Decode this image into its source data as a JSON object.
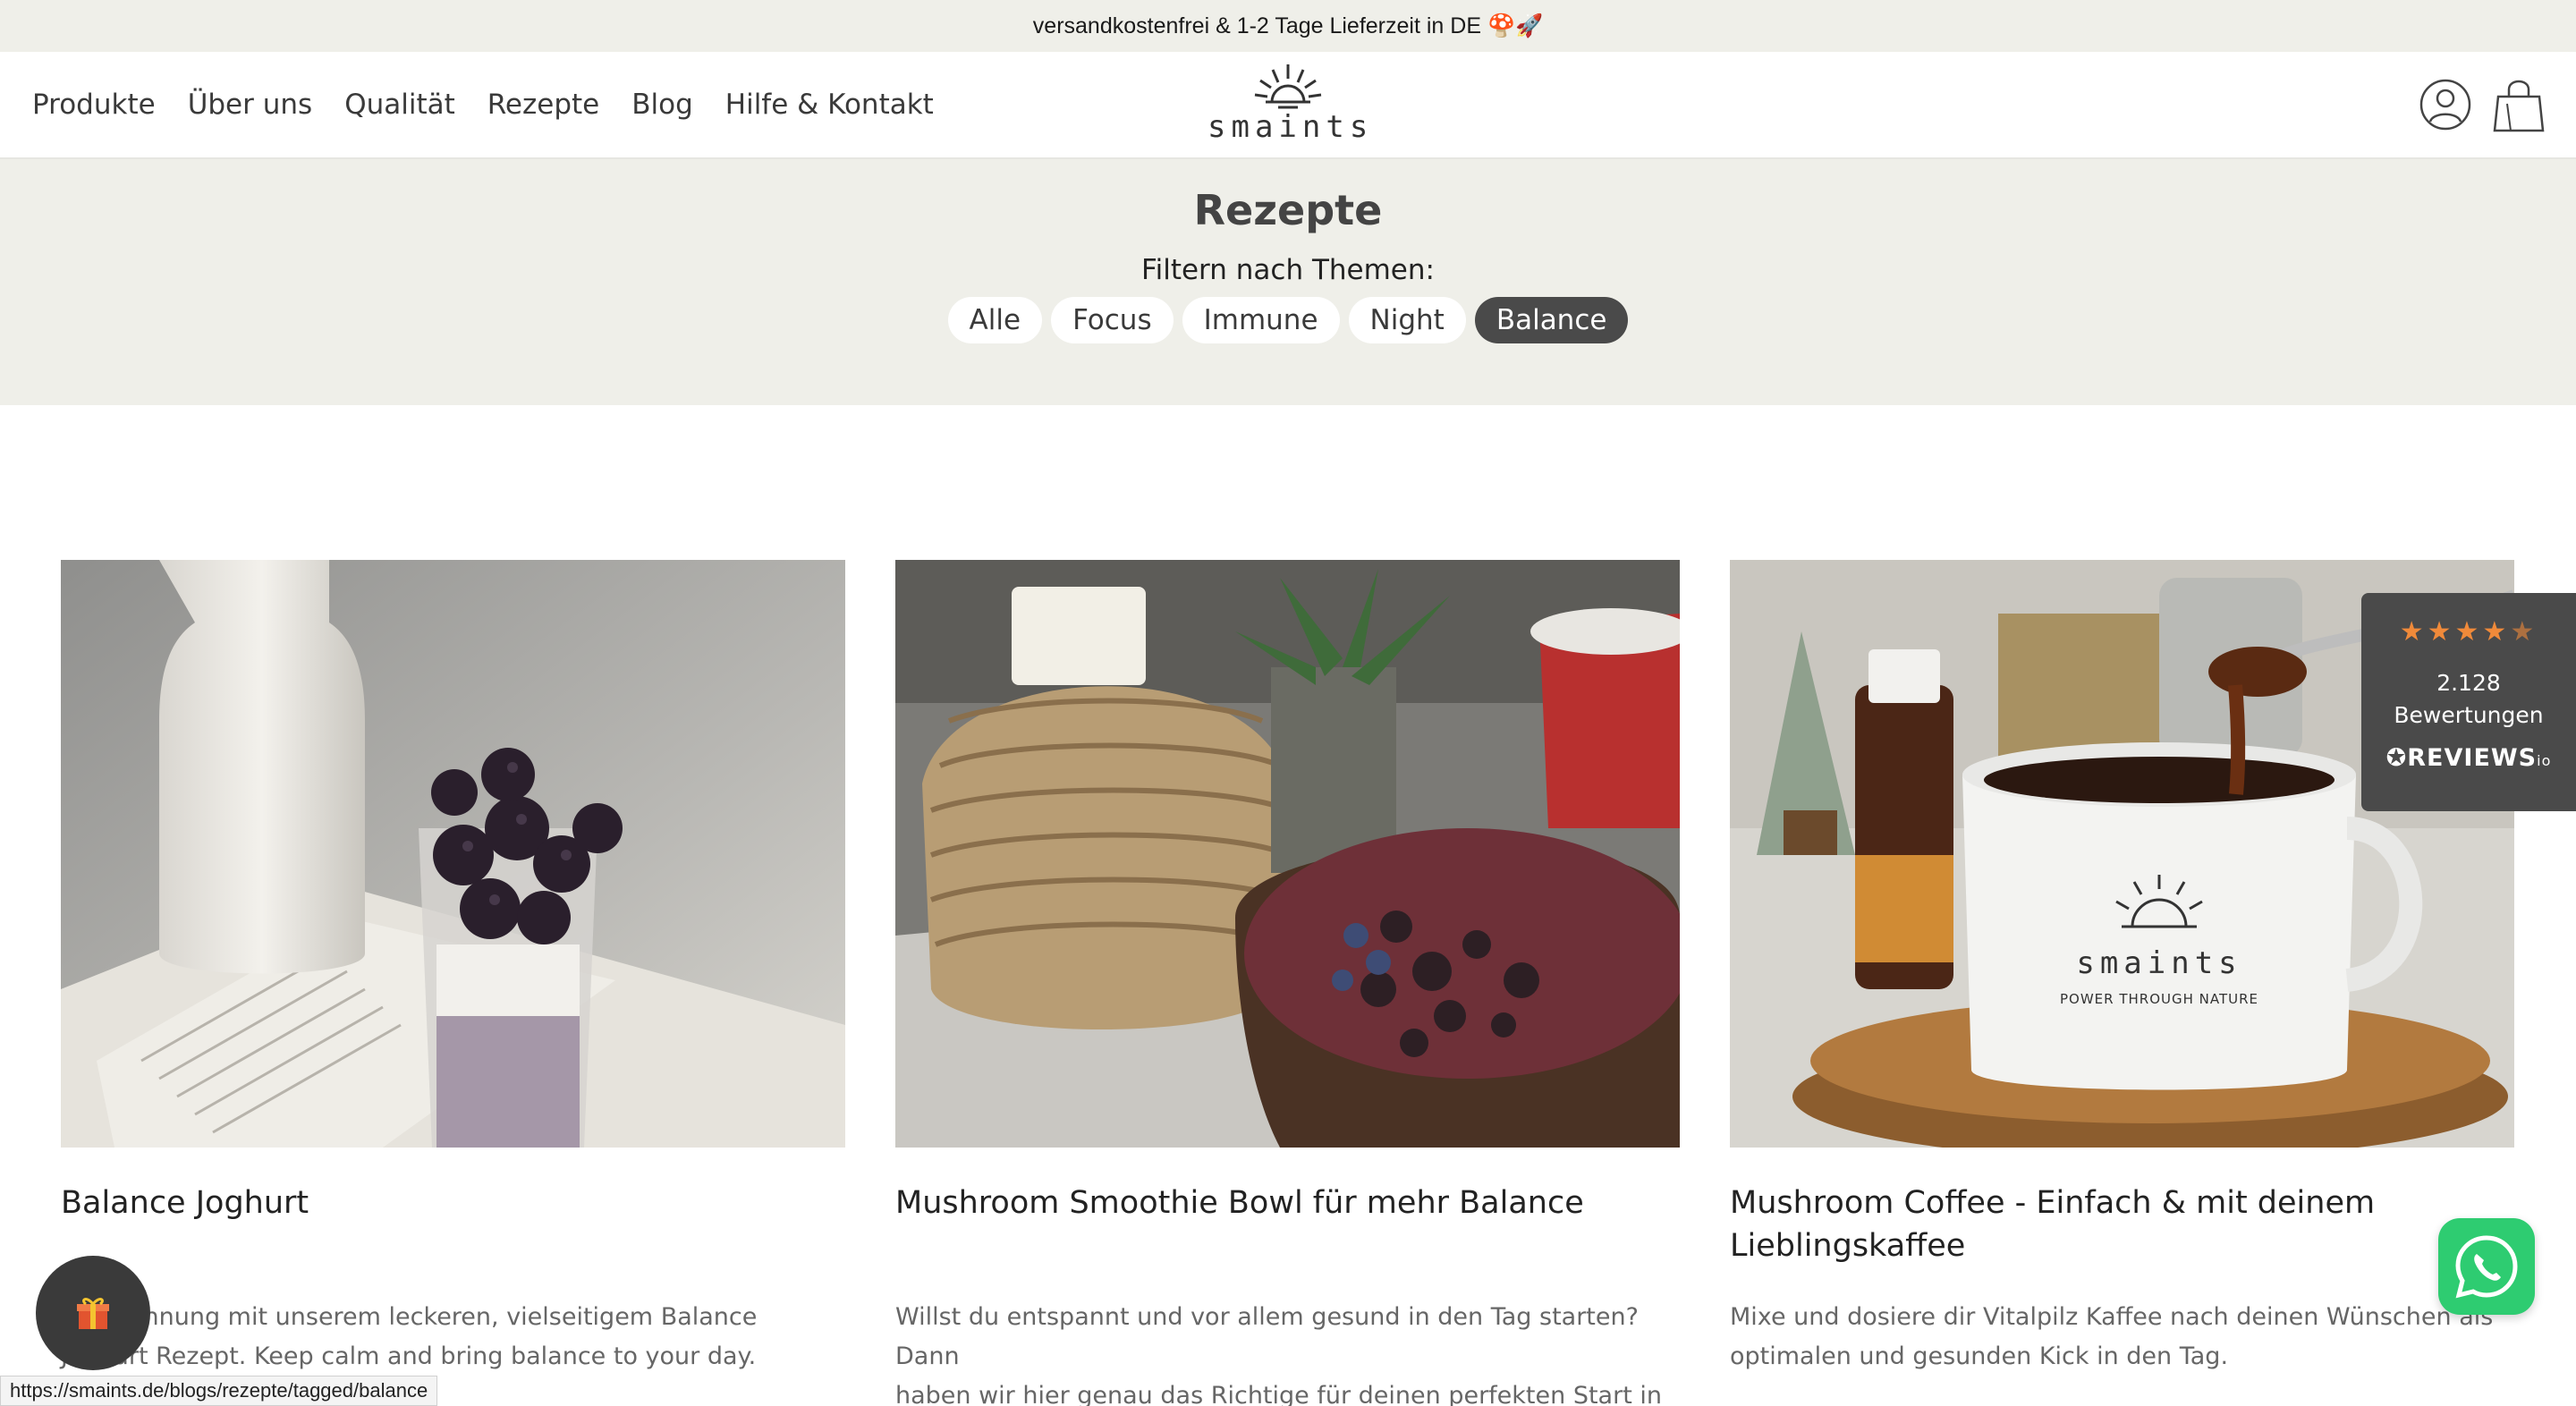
{
  "announcement": {
    "text": "versandkostenfrei & 1-2 Tage Lieferzeit in DE 🍄🚀"
  },
  "nav": {
    "items": [
      "Produkte",
      "Über uns",
      "Qualität",
      "Rezepte",
      "Blog",
      "Hilfe & Kontakt"
    ]
  },
  "logo": {
    "text": "smaints",
    "icon": "sun-logo-icon"
  },
  "header_icons": [
    "account-icon",
    "shopping-bag-icon"
  ],
  "hero": {
    "title": "Rezepte",
    "filter_label": "Filtern nach Themen:",
    "chips": [
      {
        "label": "Alle",
        "active": false
      },
      {
        "label": "Focus",
        "active": false
      },
      {
        "label": "Immune",
        "active": false
      },
      {
        "label": "Night",
        "active": false
      },
      {
        "label": "Balance",
        "active": true
      }
    ]
  },
  "cards": [
    {
      "title": "Balance Joghurt",
      "excerpt_lines": [
        "Entspannung mit unserem leckeren, vielseitigem Balance",
        "Joghurt Rezept. Keep calm and bring balance to your day."
      ],
      "image": "yogurt-with-blackberries-photo"
    },
    {
      "title": "Mushroom Smoothie Bowl für mehr Balance",
      "excerpt_lines": [
        "Willst du entspannt und vor allem gesund in den Tag starten? Dann",
        "haben wir hier genau das Richtige für deinen perfekten Start in de..."
      ],
      "image": "smoothie-bowl-photo"
    },
    {
      "title_lines": [
        "Mushroom Coffee - Einfach & mit deinem",
        "Lieblingskaffee"
      ],
      "excerpt_lines": [
        "Mixe und dosiere dir Vitalpilz Kaffee nach deinen Wünschen als",
        "optimalen und gesunden Kick in den Tag."
      ],
      "image": "mushroom-coffee-mug-photo",
      "mug_text": "smaints",
      "mug_slogan": "POWER THROUGH NATURE"
    }
  ],
  "reviews": {
    "rating": 4.5,
    "count_line": "2.128",
    "label": "Bewertungen",
    "brand": "REVIEWS",
    "brand_suffix": "io",
    "star_color": "#f08a3a"
  },
  "whatsapp": {
    "icon": "whatsapp-icon",
    "color": "#2ecc71"
  },
  "gift": {
    "icon": "gift-icon"
  },
  "status_url": "https://smaints.de/blogs/rezepte/tagged/balance"
}
